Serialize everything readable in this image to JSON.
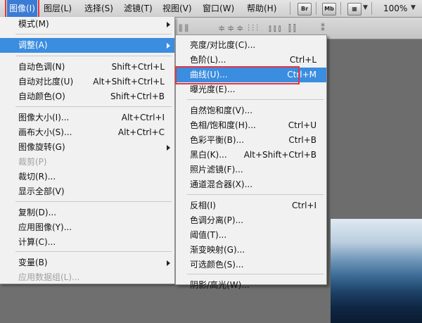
{
  "menubar": {
    "items": [
      {
        "label": "图像(I)"
      },
      {
        "label": "图层(L)"
      },
      {
        "label": "选择(S)"
      },
      {
        "label": "滤镜(T)"
      },
      {
        "label": "视图(V)"
      },
      {
        "label": "窗口(W)"
      },
      {
        "label": "帮助(H)"
      }
    ],
    "buttons": [
      "Br",
      "Mb"
    ],
    "zoom": "100%"
  },
  "image_menu": {
    "items": [
      {
        "label": "模式(M)",
        "shortcut": "",
        "submenu": true,
        "disabled": false
      },
      {
        "label": "调整(A)",
        "shortcut": "",
        "submenu": true,
        "disabled": false,
        "highlighted": true
      },
      {
        "label": "自动色调(N)",
        "shortcut": "Shift+Ctrl+L",
        "submenu": false,
        "disabled": false
      },
      {
        "label": "自动对比度(U)",
        "shortcut": "Alt+Shift+Ctrl+L",
        "submenu": false,
        "disabled": false
      },
      {
        "label": "自动颜色(O)",
        "shortcut": "Shift+Ctrl+B",
        "submenu": false,
        "disabled": false
      },
      {
        "label": "图像大小(I)...",
        "shortcut": "Alt+Ctrl+I",
        "submenu": false,
        "disabled": false
      },
      {
        "label": "画布大小(S)...",
        "shortcut": "Alt+Ctrl+C",
        "submenu": false,
        "disabled": false
      },
      {
        "label": "图像旋转(G)",
        "shortcut": "",
        "submenu": true,
        "disabled": false
      },
      {
        "label": "裁剪(P)",
        "shortcut": "",
        "submenu": false,
        "disabled": true
      },
      {
        "label": "裁切(R)...",
        "shortcut": "",
        "submenu": false,
        "disabled": false
      },
      {
        "label": "显示全部(V)",
        "shortcut": "",
        "submenu": false,
        "disabled": false
      },
      {
        "label": "复制(D)...",
        "shortcut": "",
        "submenu": false,
        "disabled": false
      },
      {
        "label": "应用图像(Y)...",
        "shortcut": "",
        "submenu": false,
        "disabled": false
      },
      {
        "label": "计算(C)...",
        "shortcut": "",
        "submenu": false,
        "disabled": false
      },
      {
        "label": "变量(B)",
        "shortcut": "",
        "submenu": true,
        "disabled": false
      },
      {
        "label": "应用数据组(L)...",
        "shortcut": "",
        "submenu": false,
        "disabled": true
      }
    ]
  },
  "adjust_submenu": {
    "items": [
      {
        "label": "亮度/对比度(C)...",
        "shortcut": ""
      },
      {
        "label": "色阶(L)...",
        "shortcut": "Ctrl+L"
      },
      {
        "label": "曲线(U)...",
        "shortcut": "Ctrl+M",
        "highlighted": true
      },
      {
        "label": "曝光度(E)...",
        "shortcut": ""
      },
      {
        "label": "自然饱和度(V)...",
        "shortcut": ""
      },
      {
        "label": "色相/饱和度(H)...",
        "shortcut": "Ctrl+U"
      },
      {
        "label": "色彩平衡(B)...",
        "shortcut": "Ctrl+B"
      },
      {
        "label": "黑白(K)...",
        "shortcut": "Alt+Shift+Ctrl+B"
      },
      {
        "label": "照片滤镜(F)...",
        "shortcut": ""
      },
      {
        "label": "通道混合器(X)...",
        "shortcut": ""
      },
      {
        "label": "反相(I)",
        "shortcut": "Ctrl+I"
      },
      {
        "label": "色调分离(P)...",
        "shortcut": ""
      },
      {
        "label": "阈值(T)...",
        "shortcut": ""
      },
      {
        "label": "渐变映射(G)...",
        "shortcut": ""
      },
      {
        "label": "可选颜色(S)...",
        "shortcut": ""
      },
      {
        "label": "阴影/高光(W)...",
        "shortcut": ""
      }
    ]
  },
  "colors": {
    "highlight": "#3b8de0",
    "annotation": "#e5363e"
  }
}
